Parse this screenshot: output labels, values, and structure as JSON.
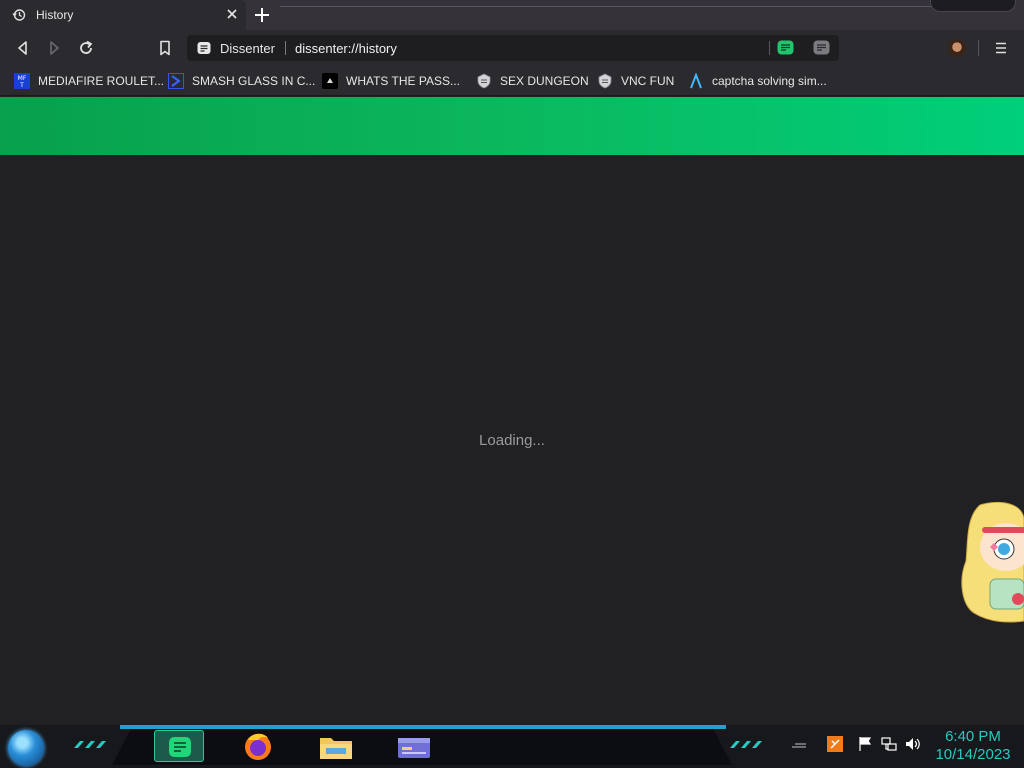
{
  "tab": {
    "title": "History",
    "icon": "history-icon"
  },
  "toolbar": {
    "site_name": "Dissenter",
    "url": "dissenter://history"
  },
  "bookmarks": [
    {
      "label": "MEDIAFIRE ROULET...",
      "icon": "mediafire-icon"
    },
    {
      "label": "SMASH GLASS IN C...",
      "icon": "chevron-bookmark-icon"
    },
    {
      "label": "WHATS THE PASS...",
      "icon": "terminal-bookmark-icon"
    },
    {
      "label": "SEX DUNGEON",
      "icon": "shield-bookmark-icon"
    },
    {
      "label": "VNC FUN",
      "icon": "shield-bookmark-icon"
    },
    {
      "label": "captcha solving sim...",
      "icon": "lambda-bookmark-icon"
    }
  ],
  "page": {
    "loading_text": "Loading..."
  },
  "taskbar": {
    "time": "6:40 PM",
    "date": "10/14/2023"
  },
  "colors": {
    "accent_green": "#00cf7a",
    "page_bg": "#212124",
    "clock": "#27c9c1"
  }
}
